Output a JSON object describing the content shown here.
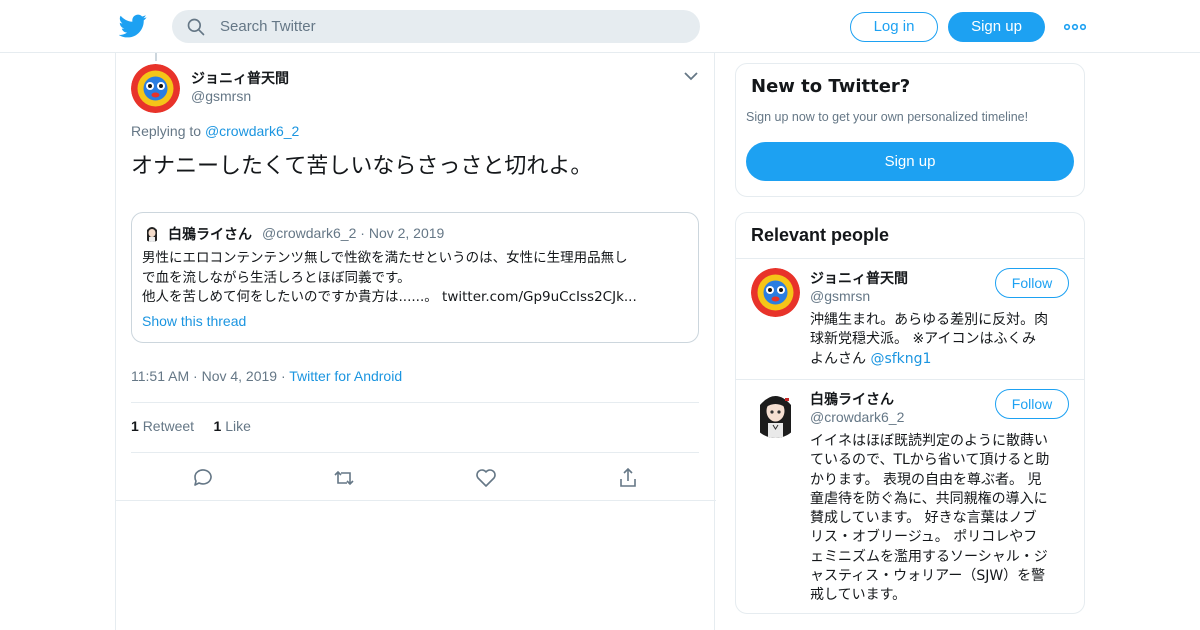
{
  "header": {
    "search_placeholder": "Search Twitter",
    "login_label": "Log in",
    "signup_label": "Sign up",
    "brand_color": "#1da1f2"
  },
  "tweet": {
    "author_name": "ジョニィ普天間",
    "author_handle": "@gsmrsn",
    "replying_prefix": "Replying to",
    "replying_to": "@crowdark6_2",
    "text": "オナニーしたくて苦しいならさっさと切れよ。",
    "quote": {
      "author_name": "白鴉ライさん",
      "author_handle": "@crowdark6_2",
      "date": "Nov 2, 2019",
      "lines": [
        "男性にエロコンテンテンツ無しで性欲を満たせというのは、女性に生理用品無し",
        "で血を流しながら生活しろとほぼ同義です。",
        "他人を苦しめて何をしたいのですか貴方は......。 twitter.com/Gp9uCcIss2CJk..."
      ],
      "show_thread": "Show this thread"
    },
    "time": "11:51 AM",
    "date": "Nov 4, 2019",
    "source": "Twitter for Android",
    "retweet_count": "1",
    "retweet_label": "Retweet",
    "like_count": "1",
    "like_label": "Like"
  },
  "sidebar": {
    "new_title": "New to Twitter?",
    "new_sub": "Sign up now to get your own personalized timeline!",
    "new_signup": "Sign up",
    "relevant_title": "Relevant people",
    "follow_label": "Follow",
    "people": [
      {
        "name": "ジョニィ普天間",
        "handle": "@gsmrsn",
        "bio_lines": [
          "沖縄生まれ。あらゆる差別に反対。肉",
          "球新党穏犬派。 ※アイコンはふくみ",
          "よんさん"
        ],
        "bio_mention": "@sfkng1"
      },
      {
        "name": "白鴉ライさん",
        "handle": "@crowdark6_2",
        "bio_lines": [
          "イイネはほぼ既読判定のように散蒔い",
          "ているので、TLから省いて頂けると助",
          "かります。 表現の自由を尊ぶ者。 児",
          "童虐待を防ぐ為に、共同親権の導入に",
          "賛成しています。 好きな言葉はノブ",
          "リス・オブリージュ。 ポリコレやフ",
          "ェミニズムを濫用するソーシャル・ジ",
          "ャスティス・ウォリアー（SJW）を警",
          "戒しています。"
        ]
      }
    ]
  }
}
